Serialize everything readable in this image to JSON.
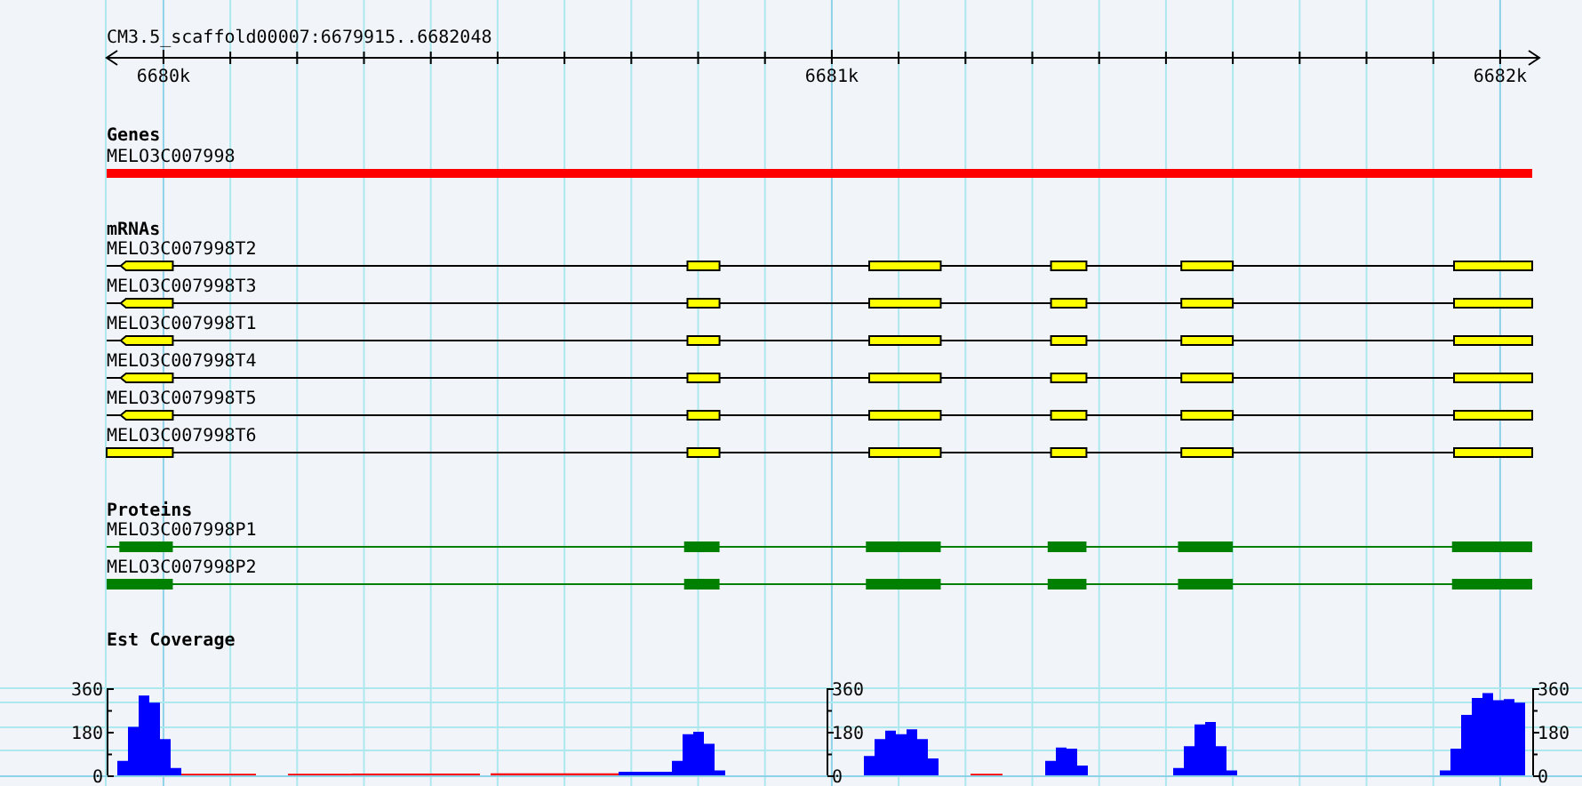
{
  "ruler": {
    "title": "CM3.5_scaffold00007:6679915..6682048",
    "tick_labels": [
      "6680k",
      "6681k",
      "6682k"
    ]
  },
  "genes": {
    "title": "Genes",
    "items": [
      {
        "name": "MELO3C007998"
      }
    ]
  },
  "mrnas": {
    "title": "mRNAs",
    "items": [
      {
        "name": "MELO3C007998T2"
      },
      {
        "name": "MELO3C007998T3"
      },
      {
        "name": "MELO3C007998T1"
      },
      {
        "name": "MELO3C007998T4"
      },
      {
        "name": "MELO3C007998T5"
      },
      {
        "name": "MELO3C007998T6"
      }
    ]
  },
  "proteins": {
    "title": "Proteins",
    "items": [
      {
        "name": "MELO3C007998P1"
      },
      {
        "name": "MELO3C007998P2"
      }
    ]
  },
  "coverage": {
    "title": "Est Coverage",
    "axes": [
      {
        "labels": [
          "360",
          "180",
          "0"
        ]
      },
      {
        "labels": [
          "360",
          "180",
          "0"
        ]
      },
      {
        "labels": [
          "360",
          "180",
          "0"
        ]
      }
    ]
  }
}
